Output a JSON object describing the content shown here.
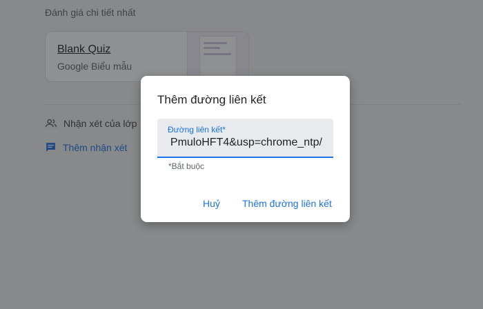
{
  "page": {
    "section_title": "Đánh giá chi tiết nhất",
    "card": {
      "title": "Blank Quiz",
      "subtitle": "Google Biểu mẫu"
    },
    "comments_label": "Nhận xét của lớp",
    "add_comment_label": "Thêm nhận xét"
  },
  "dialog": {
    "title": "Thêm đường liên kết",
    "field_label": "Đường liên kết*",
    "field_value": "/PmuloHFT4&usp=chrome_ntp",
    "helper_text": "*Bắt buộc",
    "cancel_label": "Huỷ",
    "confirm_label": "Thêm đường liên kết"
  },
  "icons": {
    "comments": "people-icon",
    "add_comment": "comment-icon"
  },
  "colors": {
    "accent": "#1a73e8",
    "overlay": "rgba(32,33,36,0.5)"
  }
}
